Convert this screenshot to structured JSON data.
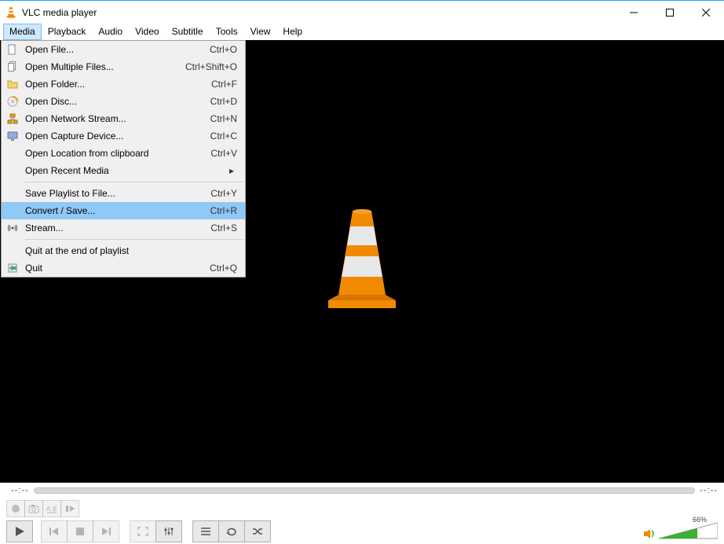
{
  "title": "VLC media player",
  "menubar": {
    "items": [
      "Media",
      "Playback",
      "Audio",
      "Video",
      "Subtitle",
      "Tools",
      "View",
      "Help"
    ],
    "open_index": 0
  },
  "media_menu": [
    {
      "type": "item",
      "icon": "file",
      "label": "Open File...",
      "shortcut": "Ctrl+O"
    },
    {
      "type": "item",
      "icon": "files",
      "label": "Open Multiple Files...",
      "shortcut": "Ctrl+Shift+O"
    },
    {
      "type": "item",
      "icon": "folder",
      "label": "Open Folder...",
      "shortcut": "Ctrl+F"
    },
    {
      "type": "item",
      "icon": "disc",
      "label": "Open Disc...",
      "shortcut": "Ctrl+D"
    },
    {
      "type": "item",
      "icon": "network",
      "label": "Open Network Stream...",
      "shortcut": "Ctrl+N"
    },
    {
      "type": "item",
      "icon": "capture",
      "label": "Open Capture Device...",
      "shortcut": "Ctrl+C"
    },
    {
      "type": "item",
      "icon": "",
      "label": "Open Location from clipboard",
      "shortcut": "Ctrl+V"
    },
    {
      "type": "item",
      "icon": "",
      "label": "Open Recent Media",
      "shortcut": "",
      "submenu": true
    },
    {
      "type": "sep"
    },
    {
      "type": "item",
      "icon": "",
      "label": "Save Playlist to File...",
      "shortcut": "Ctrl+Y"
    },
    {
      "type": "item",
      "icon": "",
      "label": "Convert / Save...",
      "shortcut": "Ctrl+R",
      "highlight": true
    },
    {
      "type": "item",
      "icon": "stream",
      "label": "Stream...",
      "shortcut": "Ctrl+S"
    },
    {
      "type": "sep"
    },
    {
      "type": "item",
      "icon": "",
      "label": "Quit at the end of playlist",
      "shortcut": ""
    },
    {
      "type": "item",
      "icon": "quit",
      "label": "Quit",
      "shortcut": "Ctrl+Q"
    }
  ],
  "seek": {
    "elapsed": "--:--",
    "total": "--:--"
  },
  "volume": {
    "percent": "66%"
  }
}
